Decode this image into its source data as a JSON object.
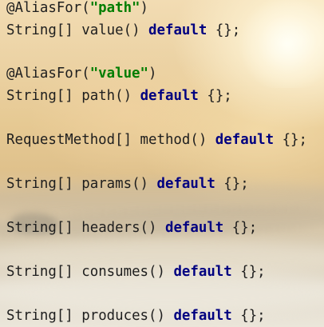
{
  "code_lines": [
    {
      "annotation": "@AliasFor(",
      "string_value": "\"path\"",
      "suffix": ")"
    },
    {
      "type": "String[]",
      "method": "value()",
      "keyword": "default",
      "tail": "{};"
    },
    {
      "annotation": "@AliasFor(",
      "string_value": "\"value\"",
      "suffix": ")"
    },
    {
      "type": "String[]",
      "method": "path()",
      "keyword": "default",
      "tail": "{};"
    },
    {
      "type": "RequestMethod[]",
      "method": "method()",
      "keyword": "default",
      "tail": "{};"
    },
    {
      "type": "String[]",
      "method": "params()",
      "keyword": "default",
      "tail": "{};"
    },
    {
      "type": "String[]",
      "method": "headers()",
      "keyword": "default",
      "tail": "{};"
    },
    {
      "type": "String[]",
      "method": "consumes()",
      "keyword": "default",
      "tail": "{};"
    },
    {
      "type": "String[]",
      "method": "produces()",
      "keyword": "default",
      "tail": "{};"
    }
  ],
  "colors": {
    "keyword": "#000080",
    "string": "#007d00",
    "text": "#1e1e1e"
  }
}
